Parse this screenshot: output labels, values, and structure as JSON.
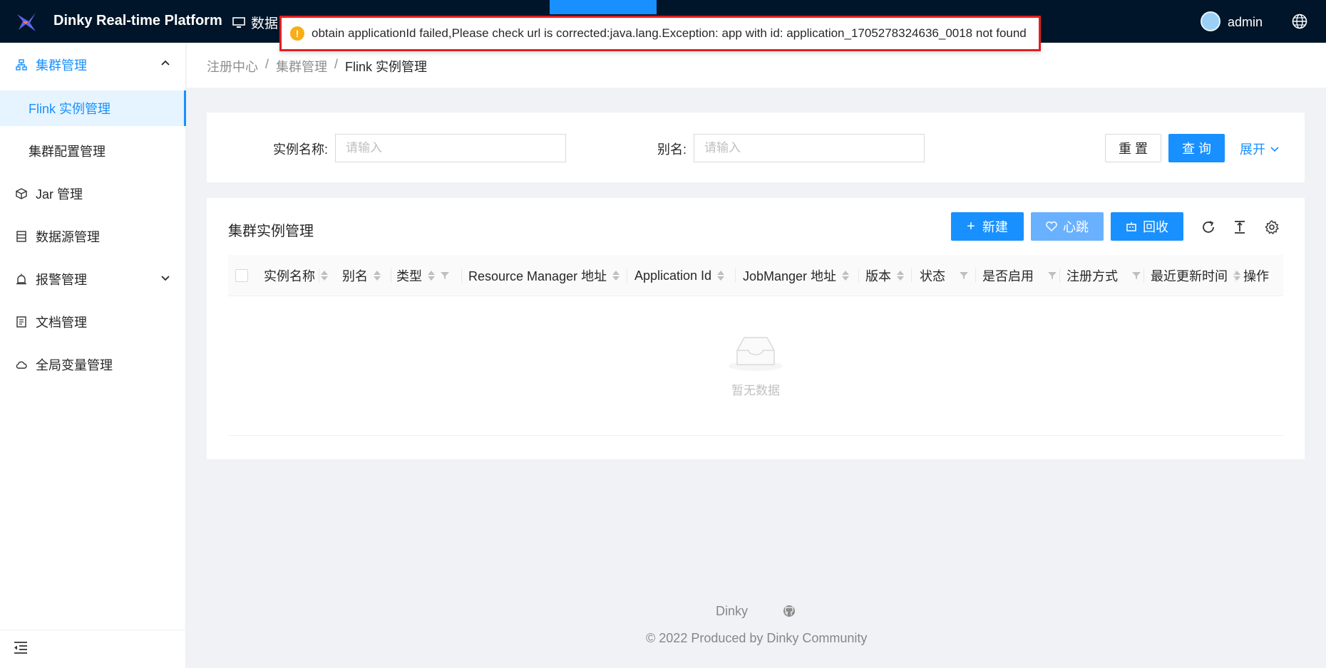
{
  "header": {
    "app_title": "Dinky Real-time Platform",
    "nav_partial": "数据",
    "username": "admin"
  },
  "toast": {
    "message": "obtain applicationId failed,Please check url is corrected:java.lang.Exception: app with id: application_1705278324636_0018 not found",
    "type": "warning",
    "highlight_color": "#e02020"
  },
  "sidebar": {
    "group_open": "集群管理",
    "sub_items": [
      "Flink 实例管理",
      "集群配置管理"
    ],
    "items": [
      "Jar 管理",
      "数据源管理",
      "报警管理",
      "文档管理",
      "全局变量管理"
    ]
  },
  "breadcrumb": [
    "注册中心",
    "集群管理",
    "Flink 实例管理"
  ],
  "search": {
    "name_label": "实例名称:",
    "name_placeholder": "请输入",
    "alias_label": "别名:",
    "alias_placeholder": "请输入",
    "reset_label": "重 置",
    "query_label": "查 询",
    "expand_label": "展开"
  },
  "table": {
    "title": "集群实例管理",
    "new_label": "新建",
    "heartbeat_label": "心跳",
    "recycle_label": "回收",
    "columns": [
      "实例名称",
      "别名",
      "类型",
      "Resource Manager 地址",
      "Application Id",
      "JobManger 地址",
      "版本",
      "状态",
      "是否启用",
      "注册方式",
      "最近更新时间",
      "操作"
    ],
    "empty_text": "暂无数据"
  },
  "footer": {
    "brand": "Dinky",
    "copyright": "2022 Produced by Dinky Community"
  },
  "colors": {
    "primary": "#1890ff",
    "header_bg": "#001529",
    "warning": "#faad14"
  }
}
